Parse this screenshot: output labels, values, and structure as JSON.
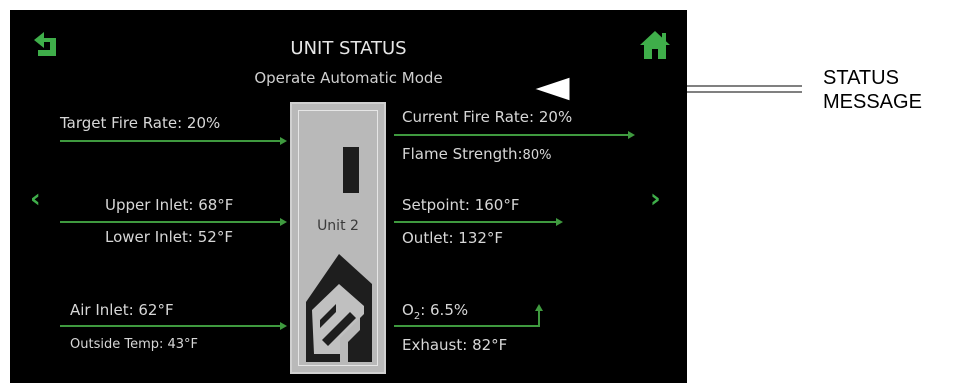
{
  "header": {
    "title": "UNIT STATUS",
    "status_message": "Operate Automatic Mode"
  },
  "unit": {
    "label": "Unit 2"
  },
  "readings": {
    "target_fire_rate": "Target Fire Rate: 20%",
    "current_fire_rate": "Current Fire Rate: 20%",
    "flame_strength": "Flame Strength:",
    "flame_strength_value": "80%",
    "upper_inlet": "Upper Inlet: 68°F",
    "lower_inlet": "Lower Inlet: 52°F",
    "setpoint": "Setpoint: 160°F",
    "outlet": "Outlet: 132°F",
    "air_inlet": "Air Inlet: 62°F",
    "outside_temp": "Outside Temp: 43°F",
    "o2": "6.5%",
    "o2_prefix": "O",
    "o2_sub": "2",
    "exhaust": "Exhaust: 82°F"
  },
  "nav": {
    "back_icon": "back-arrow-icon",
    "home_icon": "home-icon",
    "prev_glyph": "‹",
    "next_glyph": "›"
  },
  "annotation": {
    "line1": "STATUS",
    "line2": "MESSAGE"
  },
  "colors": {
    "screen_bg": "#000000",
    "accent_green": "#3fae4a",
    "text": "#d7d7d7",
    "unit_panel": "#b9b9b9"
  }
}
